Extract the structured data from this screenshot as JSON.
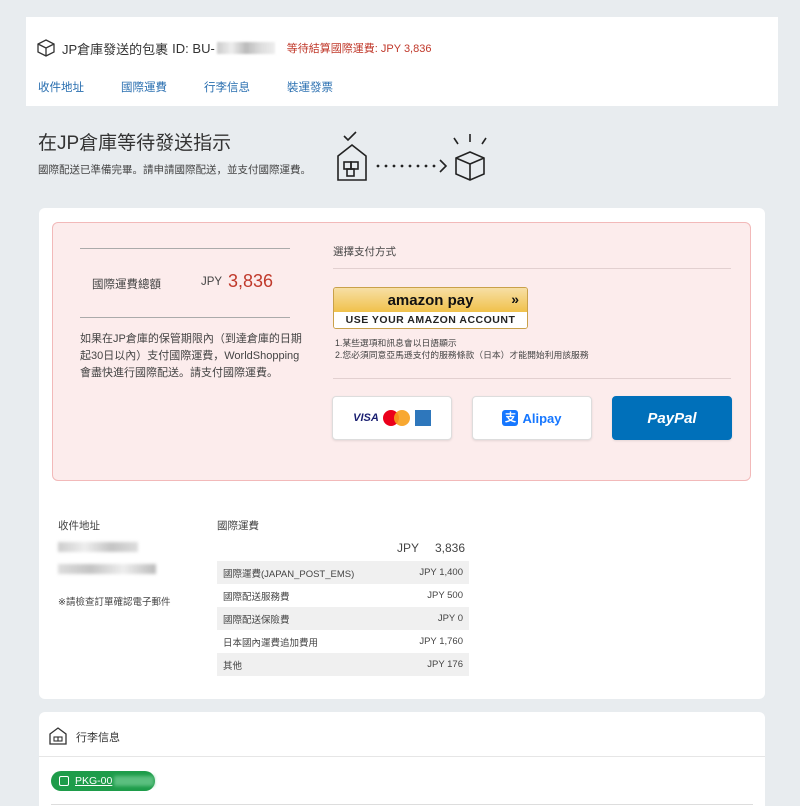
{
  "header": {
    "title": "JP倉庫發送的包裹",
    "id_prefix": "ID: BU-",
    "status": "等待結算國際運費: JPY 3,836"
  },
  "tabs": [
    "收件地址",
    "國際運費",
    "行李信息",
    "裝運發票"
  ],
  "hero": {
    "title": "在JP倉庫等待發送指示",
    "subtitle": "國際配送已準備完畢。請申請國際配送，並支付國際運費。"
  },
  "summary": {
    "label": "國際運費總額",
    "currency": "JPY",
    "amount": "3,836",
    "note": "如果在JP倉庫的保管期限內（到達倉庫的日期起30日以內）支付國際運費，WorldShopping會盡快進行國際配送。請支付國際運費。"
  },
  "payment": {
    "title": "選擇支付方式",
    "amazon": {
      "logo": "amazon pay",
      "chevron": "»",
      "caption": "USE YOUR AMAZON ACCOUNT"
    },
    "notes": [
      "1.某些選項和訊息會以日語顯示",
      "2.您必須同意亞馬遜支付的服務條款（日本）才能開始利用該服務"
    ],
    "card_label": "VISA",
    "alipay_icon": "支",
    "alipay_label": "Alipay",
    "paypal_label": "PayPal"
  },
  "address": {
    "label": "收件地址",
    "note": "※請檢查訂單確認電子郵件"
  },
  "shipping": {
    "label": "國際運費",
    "total_currency": "JPY",
    "total_amount": "3,836",
    "rows": [
      {
        "name": "國際運費(JAPAN_POST_EMS)",
        "value": "JPY 1,400"
      },
      {
        "name": "國際配送服務費",
        "value": "JPY 500"
      },
      {
        "name": "國際配送保險費",
        "value": "JPY 0"
      },
      {
        "name": "日本國內運費追加費用",
        "value": "JPY 1,760"
      },
      {
        "name": "其他",
        "value": "JPY 176"
      }
    ]
  },
  "baggage": {
    "title": "行李信息",
    "tag_prefix": "PKG-00"
  },
  "colors": {
    "accent": "#2a6fb0",
    "status_red": "#c0392b",
    "paypal_blue": "#0070ba",
    "tag_green": "#1e9c4a"
  }
}
